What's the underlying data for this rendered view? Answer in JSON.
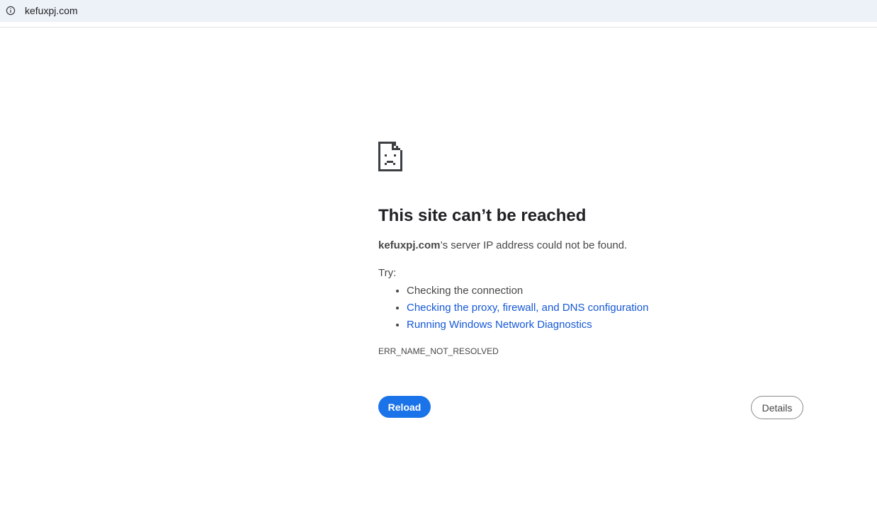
{
  "browser": {
    "url": "kefuxpj.com",
    "info_icon": "info-icon"
  },
  "error_page": {
    "icon": "sad-page-icon",
    "heading": "This site can’t be reached",
    "summary_host": "kefuxpj.com",
    "summary_rest": "’s server IP address could not be found.",
    "try_label": "Try:",
    "suggestions": [
      {
        "label": "Checking the connection",
        "is_link": false
      },
      {
        "label": "Checking the proxy, firewall, and DNS configuration",
        "is_link": true
      },
      {
        "label": "Running Windows Network Diagnostics",
        "is_link": true
      }
    ],
    "error_code": "ERR_NAME_NOT_RESOLVED",
    "reload_label": "Reload",
    "details_label": "Details",
    "colors": {
      "link": "#1558d6",
      "primary_button": "#1a73e8",
      "text": "#474747",
      "heading": "#202124"
    }
  }
}
